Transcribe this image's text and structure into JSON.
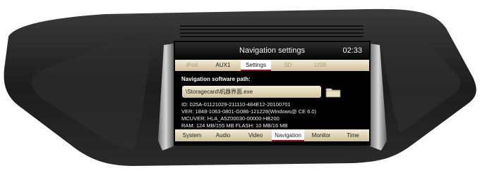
{
  "screen": {
    "title": "Navigation settings",
    "clock": "02:33",
    "top_tabs": [
      {
        "label": "iPod",
        "state": "dim"
      },
      {
        "label": "AUX1",
        "state": "normal"
      },
      {
        "label": "Settings",
        "state": "active"
      },
      {
        "label": "SD",
        "state": "dim"
      },
      {
        "label": "USB",
        "state": "dim"
      }
    ],
    "path_label": "Navigation software path:",
    "path_value": "\\Storagecard\\机器界面.exe",
    "info": [
      "ID: 025A-01121029-211110-484E12-20100701",
      "VER: 1848-1063-0801-G086-121228(Windows@ CE 6.0)",
      "MCUVER: HLA_A5Z00030-00000-HB200",
      "RAM: 124 MB/155 MB   FLASH: 10 MB/16 MB"
    ],
    "bottom_tabs": [
      {
        "label": "System"
      },
      {
        "label": "Audio"
      },
      {
        "label": "Video"
      },
      {
        "label": "Navigation",
        "active": true
      },
      {
        "label": "Monitor"
      },
      {
        "label": "Time"
      }
    ]
  },
  "colors": {
    "bezel": "#2b2b2b",
    "accent_red": "#a0101a",
    "tab_beige": "#e2d8bc"
  }
}
